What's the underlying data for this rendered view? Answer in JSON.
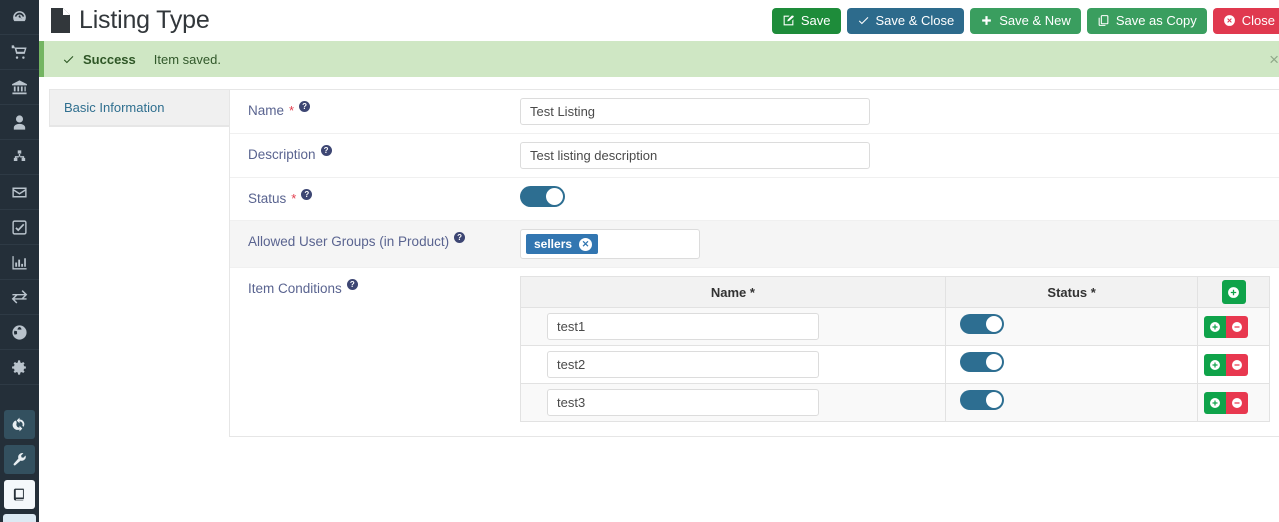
{
  "sidebar": {
    "items": [
      {
        "name": "dashboard",
        "icon": "gauge-icon"
      },
      {
        "name": "shop",
        "icon": "cart-icon"
      },
      {
        "name": "bank",
        "icon": "bank-icon"
      },
      {
        "name": "users",
        "icon": "user-icon"
      },
      {
        "name": "structure",
        "icon": "sitemap-icon"
      },
      {
        "name": "messages",
        "icon": "envelope-icon"
      },
      {
        "name": "tasks",
        "icon": "check-square-icon"
      },
      {
        "name": "reports",
        "icon": "bar-chart-icon"
      },
      {
        "name": "transfers",
        "icon": "exchange-icon"
      },
      {
        "name": "global",
        "icon": "globe-icon"
      },
      {
        "name": "settings",
        "icon": "gear-icon"
      }
    ],
    "boxed_items": [
      {
        "name": "sync",
        "icon": "refresh-icon",
        "active": false
      },
      {
        "name": "tools",
        "icon": "wrench-icon",
        "active": false
      },
      {
        "name": "catalog",
        "icon": "book-icon",
        "active": true
      }
    ]
  },
  "header": {
    "title": "Listing Type",
    "title_icon": "file-icon"
  },
  "toolbar": {
    "save_label": "Save",
    "save_close_label": "Save & Close",
    "save_new_label": "Save & New",
    "save_copy_label": "Save as Copy",
    "close_label": "Close"
  },
  "alert": {
    "status": "Success",
    "message": "Item saved.",
    "dismiss_label": "×",
    "check_icon": "check-icon",
    "background_color": "#cfe7c4",
    "accent_color": "#74b562"
  },
  "tabs": {
    "items": [
      {
        "label": "Basic Information",
        "active": true
      }
    ]
  },
  "form": {
    "name": {
      "label": "Name",
      "required_marker": "*",
      "help_glyph": "?",
      "value": "Test Listing",
      "placeholder": ""
    },
    "description": {
      "label": "Description",
      "help_glyph": "?",
      "value": "Test listing description",
      "placeholder": ""
    },
    "status": {
      "label": "Status",
      "required_marker": "*",
      "help_glyph": "?",
      "value": "on"
    },
    "allowed_user_groups": {
      "label": "Allowed User Groups (in Product)",
      "help_glyph": "?",
      "tags": [
        {
          "label": "sellers",
          "remove_glyph": "✕"
        }
      ]
    },
    "item_conditions": {
      "label": "Item Conditions",
      "help_glyph": "?",
      "columns": [
        {
          "label": "Name",
          "required_marker": "*"
        },
        {
          "label": "Status",
          "required_marker": "*"
        }
      ],
      "add_row_glyph": "+",
      "rows": [
        {
          "name": "test1",
          "status": "on",
          "add_glyph": "+",
          "remove_glyph": "−"
        },
        {
          "name": "test2",
          "status": "on",
          "add_glyph": "+",
          "remove_glyph": "−"
        },
        {
          "name": "test3",
          "status": "on",
          "add_glyph": "+",
          "remove_glyph": "−"
        }
      ]
    }
  },
  "colors": {
    "accent_blue": "#2d6e91",
    "tag_blue": "#3276b1",
    "green": "#0fa34a",
    "red": "#e8384f",
    "label": "#5a6490",
    "sidebar": "#242f39"
  }
}
